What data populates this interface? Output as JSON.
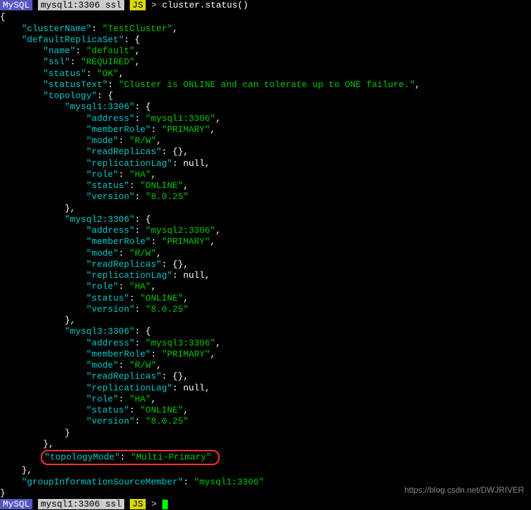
{
  "top_truncated": "                                                   ",
  "prompt1": {
    "mysql": "MySQL",
    "host": "mysql1:3306 ssl",
    "mode": "JS",
    "arrow": ">",
    "command": "cluster.status()"
  },
  "cluster": {
    "clusterName": "TestCluster",
    "defaultReplicaSet": {
      "name": "default",
      "ssl": "REQUIRED",
      "status": "OK",
      "statusText": "Cluster is ONLINE and can tolerate up to ONE failure.",
      "topology": {
        "mysql1:3306": {
          "address": "mysql1:3306",
          "memberRole": "PRIMARY",
          "mode": "R/W",
          "readReplicas": "{}",
          "replicationLag": "null",
          "role": "HA",
          "status": "ONLINE",
          "version": "8.0.25"
        },
        "mysql2:3306": {
          "address": "mysql2:3306",
          "memberRole": "PRIMARY",
          "mode": "R/W",
          "readReplicas": "{}",
          "replicationLag": "null",
          "role": "HA",
          "status": "ONLINE",
          "version": "8.0.25"
        },
        "mysql3:3306": {
          "address": "mysql3:3306",
          "memberRole": "PRIMARY",
          "mode": "R/W",
          "readReplicas": "{}",
          "replicationLag": "null",
          "role": "HA",
          "status": "ONLINE",
          "version": "8.0.25"
        }
      },
      "topologyMode": "Multi-Primary"
    },
    "groupInformationSourceMember": "mysql1:3306"
  },
  "prompt2": {
    "mysql": "MySQL",
    "host": "mysql1:3306 ssl",
    "mode": "JS",
    "arrow": ">"
  },
  "watermark": "https://blog.csdn.net/DWJRIVER"
}
